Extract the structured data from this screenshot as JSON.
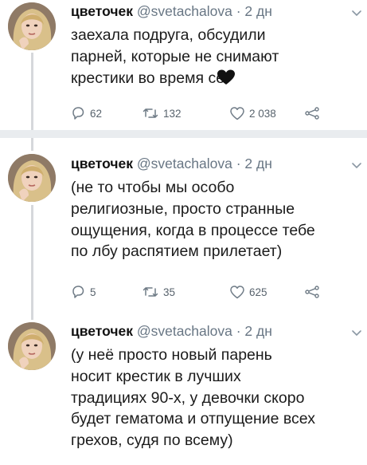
{
  "tweets": [
    {
      "name": "цветочек",
      "handle": "@svetachalova",
      "dot": "·",
      "time": "2 дн",
      "lines": [
        "заехала подруга, обсудили",
        "парней, которые не снимают",
        "крестики во время се"
      ],
      "emoji": "black-heart",
      "replies": "62",
      "retweets": "132",
      "likes": "2 038"
    },
    {
      "name": "цветочек",
      "handle": "@svetachalova",
      "dot": "·",
      "time": "2 дн",
      "lines": [
        "(не то чтобы мы особо",
        "религиозные, просто странные",
        "ощущения, когда в процессе тебе",
        "по лбу распятием прилетает)"
      ],
      "replies": "5",
      "retweets": "35",
      "likes": "625"
    },
    {
      "name": "цветочек",
      "handle": "@svetachalova",
      "dot": "·",
      "time": "2 дн",
      "lines": [
        "(у неё просто новый парень",
        "носит крестик в лучших",
        "традициях 90-х, у девочки скоро",
        "будет гематома и отпущение всех",
        "грехов, судя по всему)"
      ]
    }
  ],
  "icons": {
    "reply": "reply-icon",
    "retweet": "retweet-icon",
    "like": "heart-icon",
    "share": "share-icon",
    "menu": "chevron-down-icon"
  },
  "colors": {
    "text": "#1b1b1b",
    "muted": "#687684",
    "thread_line": "#d6d8db",
    "separator": "#e9ecef"
  }
}
